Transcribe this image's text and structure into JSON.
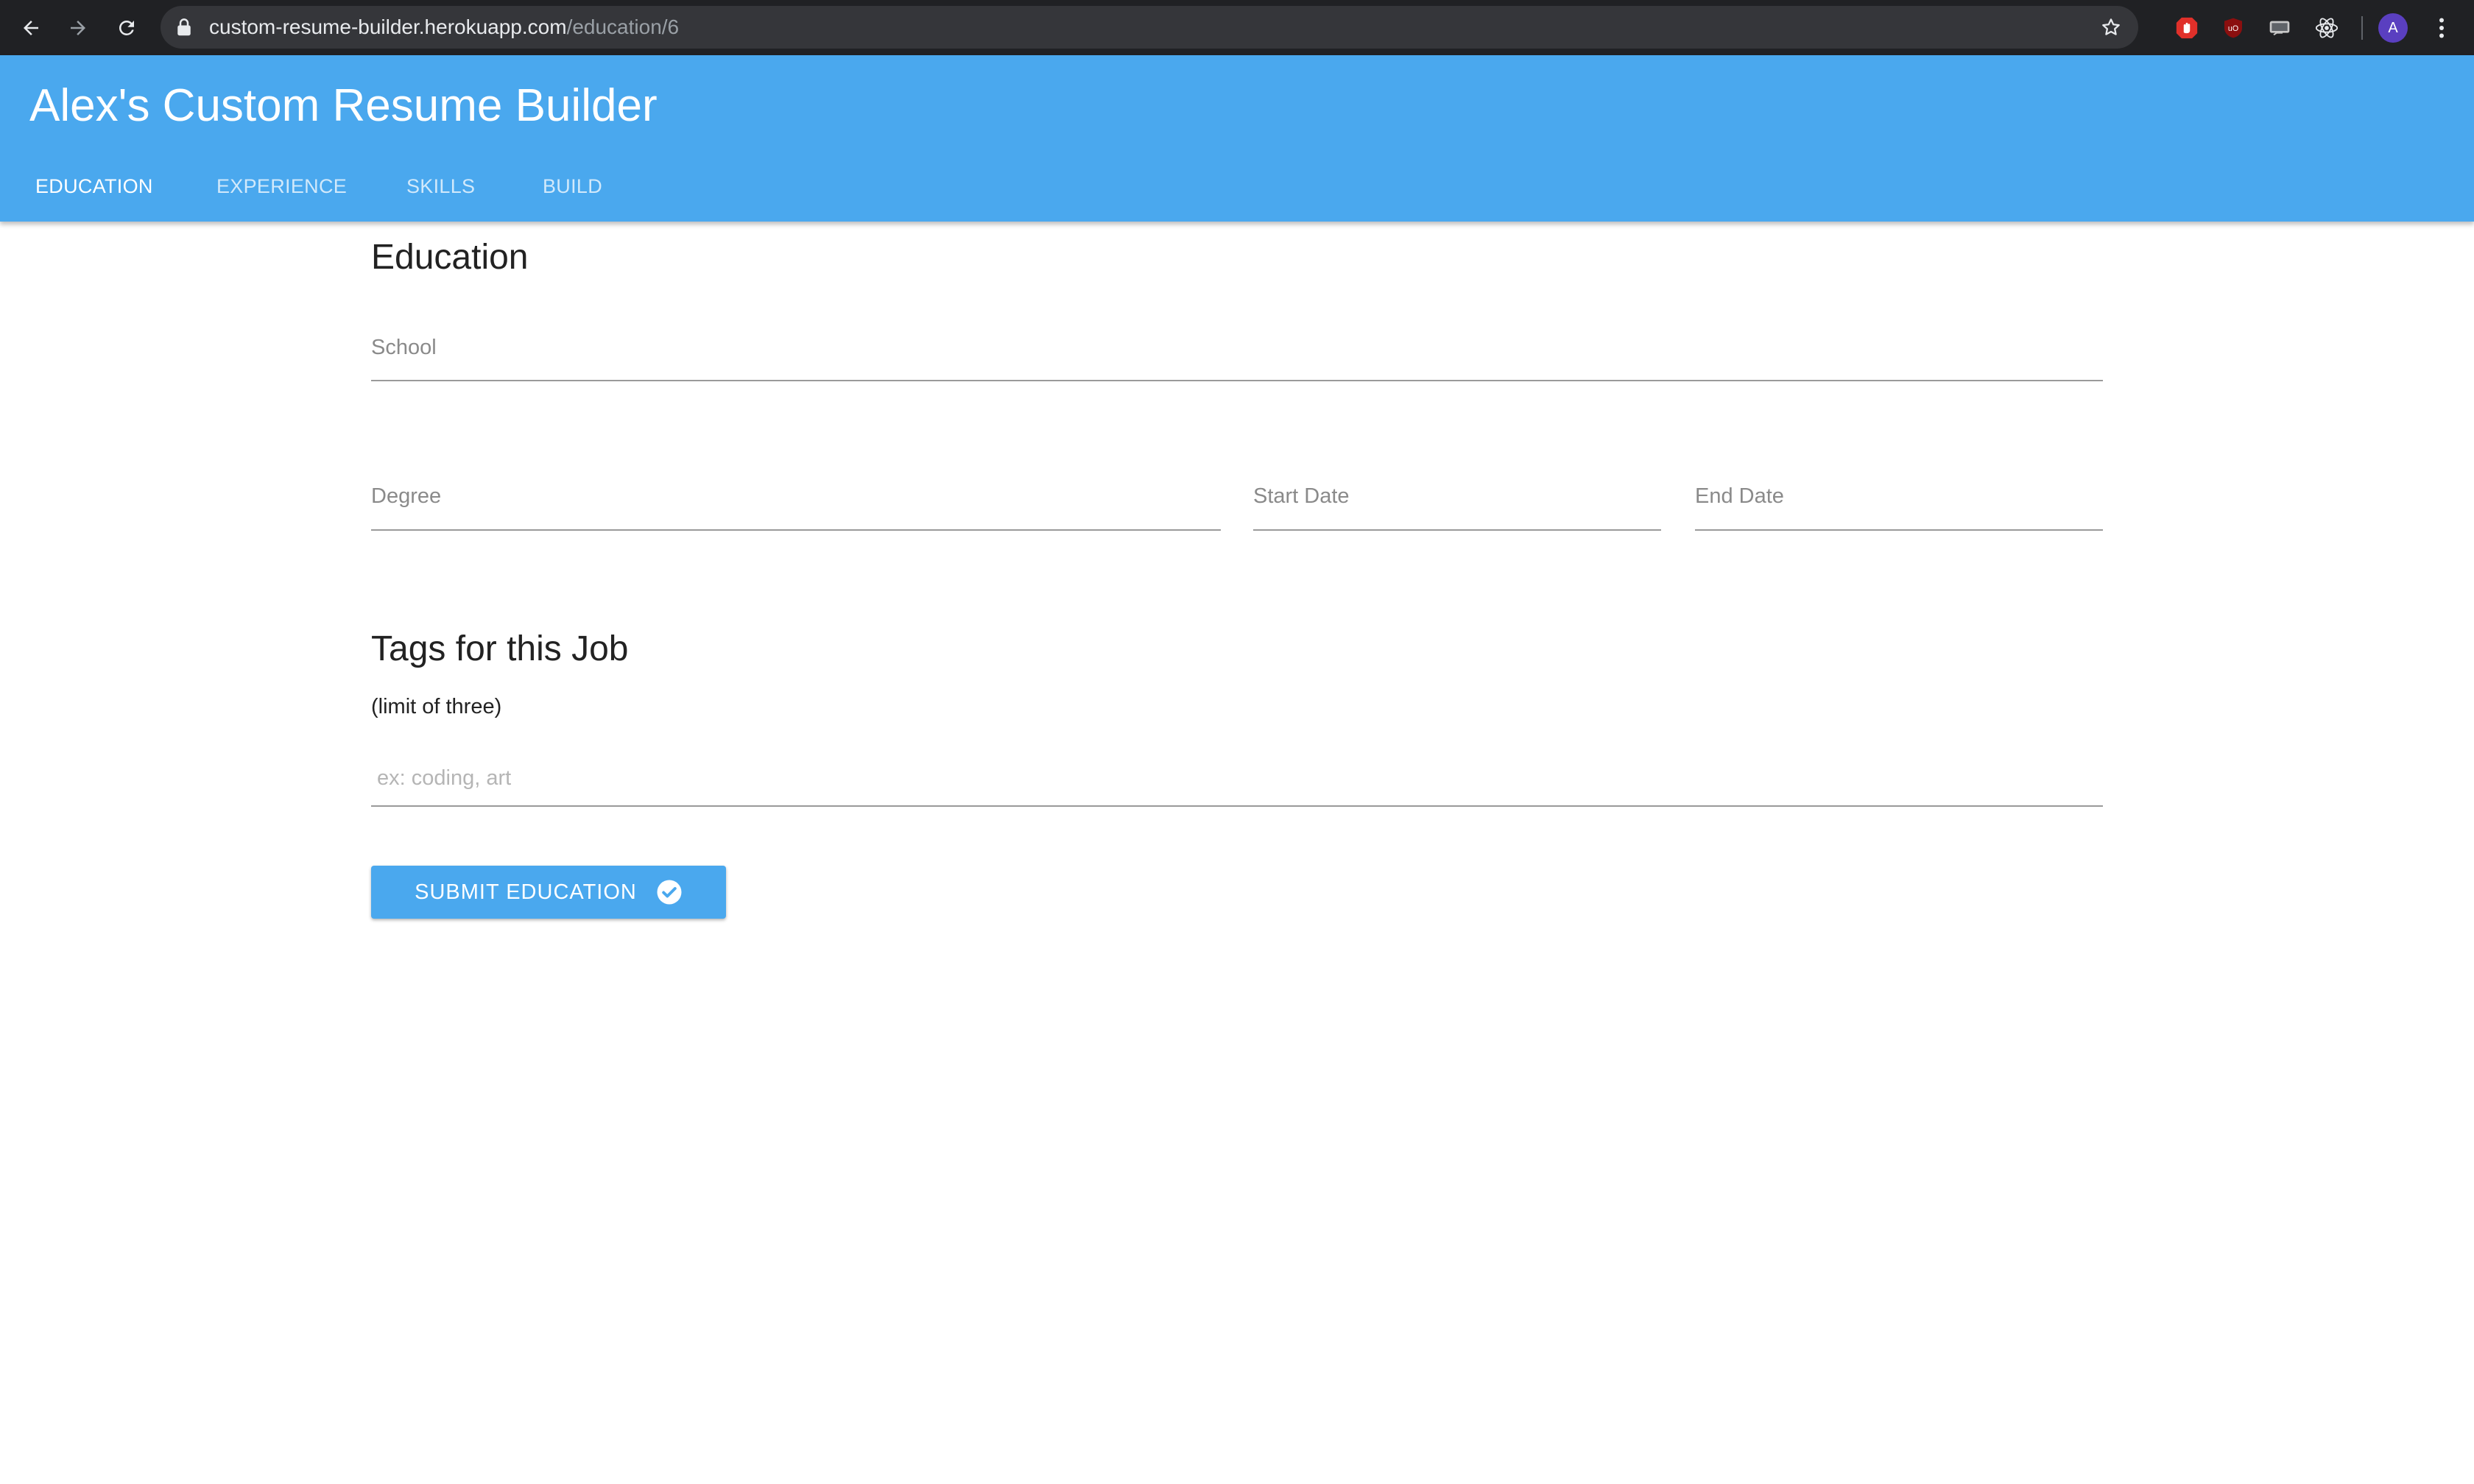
{
  "browser": {
    "url_host": "custom-resume-builder.herokuapp.com",
    "url_path": "/education/6",
    "profile_initial": "A",
    "icons": [
      "back-icon",
      "forward-icon",
      "reload-icon",
      "lock-icon",
      "star-icon",
      "adblock-extension-icon",
      "ublock-extension-icon",
      "keyboard-extension-icon",
      "react-devtools-icon",
      "kebab-menu-icon"
    ]
  },
  "app": {
    "title": "Alex's Custom Resume Builder",
    "brand_color": "#4aa8ee",
    "tabs": [
      {
        "label": "EDUCATION",
        "active": true
      },
      {
        "label": "EXPERIENCE",
        "active": false
      },
      {
        "label": "SKILLS",
        "active": false
      },
      {
        "label": "BUILD",
        "active": false
      }
    ]
  },
  "education_form": {
    "heading": "Education",
    "school_label": "School",
    "degree_label": "Degree",
    "start_date_label": "Start Date",
    "end_date_label": "End Date"
  },
  "tags_section": {
    "heading": "Tags for this Job",
    "hint": "(limit of three)",
    "placeholder": "ex: coding, art",
    "value": ""
  },
  "submit": {
    "label": "SUBMIT EDUCATION",
    "icon": "check-circle-icon"
  }
}
